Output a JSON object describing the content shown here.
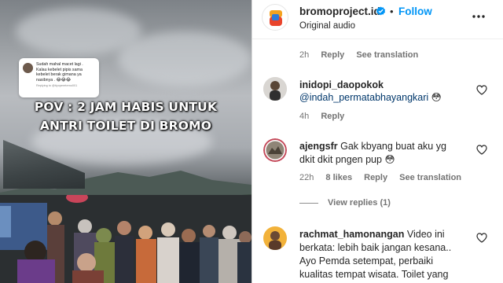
{
  "video": {
    "reply_sticker": {
      "line1": "Sudah mahal macet lagi .",
      "line2": "Kalau kebelet pipis sama",
      "line3": "kebelet berak gimana ya",
      "line4": "nasibnya . 😂😂😂",
      "sub": "Replying to @tiyoperetemo001"
    },
    "overlay_line1": "POV : 2 JAM HABIS UNTUK",
    "overlay_line2": "ANTRI TOILET DI BROMO"
  },
  "header": {
    "username": "bromoproject.id",
    "follow_label": "Follow",
    "separator": "•",
    "audio": "Original audio"
  },
  "caption_meta": {
    "time": "2h",
    "reply": "Reply",
    "translate": "See translation"
  },
  "comments": [
    {
      "username": "inidopi_daopokok",
      "mention": "@indah_permatabhayangkari",
      "emoji": "😳",
      "time": "4h",
      "reply": "Reply"
    },
    {
      "username": "ajengsfr",
      "text_line1": "Gak kbyang buat aku yg",
      "text_line2": "dkit dkit pngen pup",
      "emoji": "😳",
      "time": "22h",
      "likes": "8 likes",
      "reply": "Reply",
      "translate": "See translation"
    },
    {
      "username": "rachmat_hamonangan",
      "text_line1": "Video ini",
      "text_line2": "berkata: lebih baik jangan kesana..",
      "text_line3": "Ayo Pemda setempat, perbaiki",
      "text_line4": "kualitas tempat wisata. Toilet yang"
    }
  ],
  "view_replies": "View replies (1)",
  "colors": {
    "follow_blue": "#0095f6",
    "mention_blue": "#00376b",
    "muted_text": "#737373"
  },
  "icons": [
    "verified-badge-icon",
    "more-options-icon",
    "heart-icon"
  ]
}
